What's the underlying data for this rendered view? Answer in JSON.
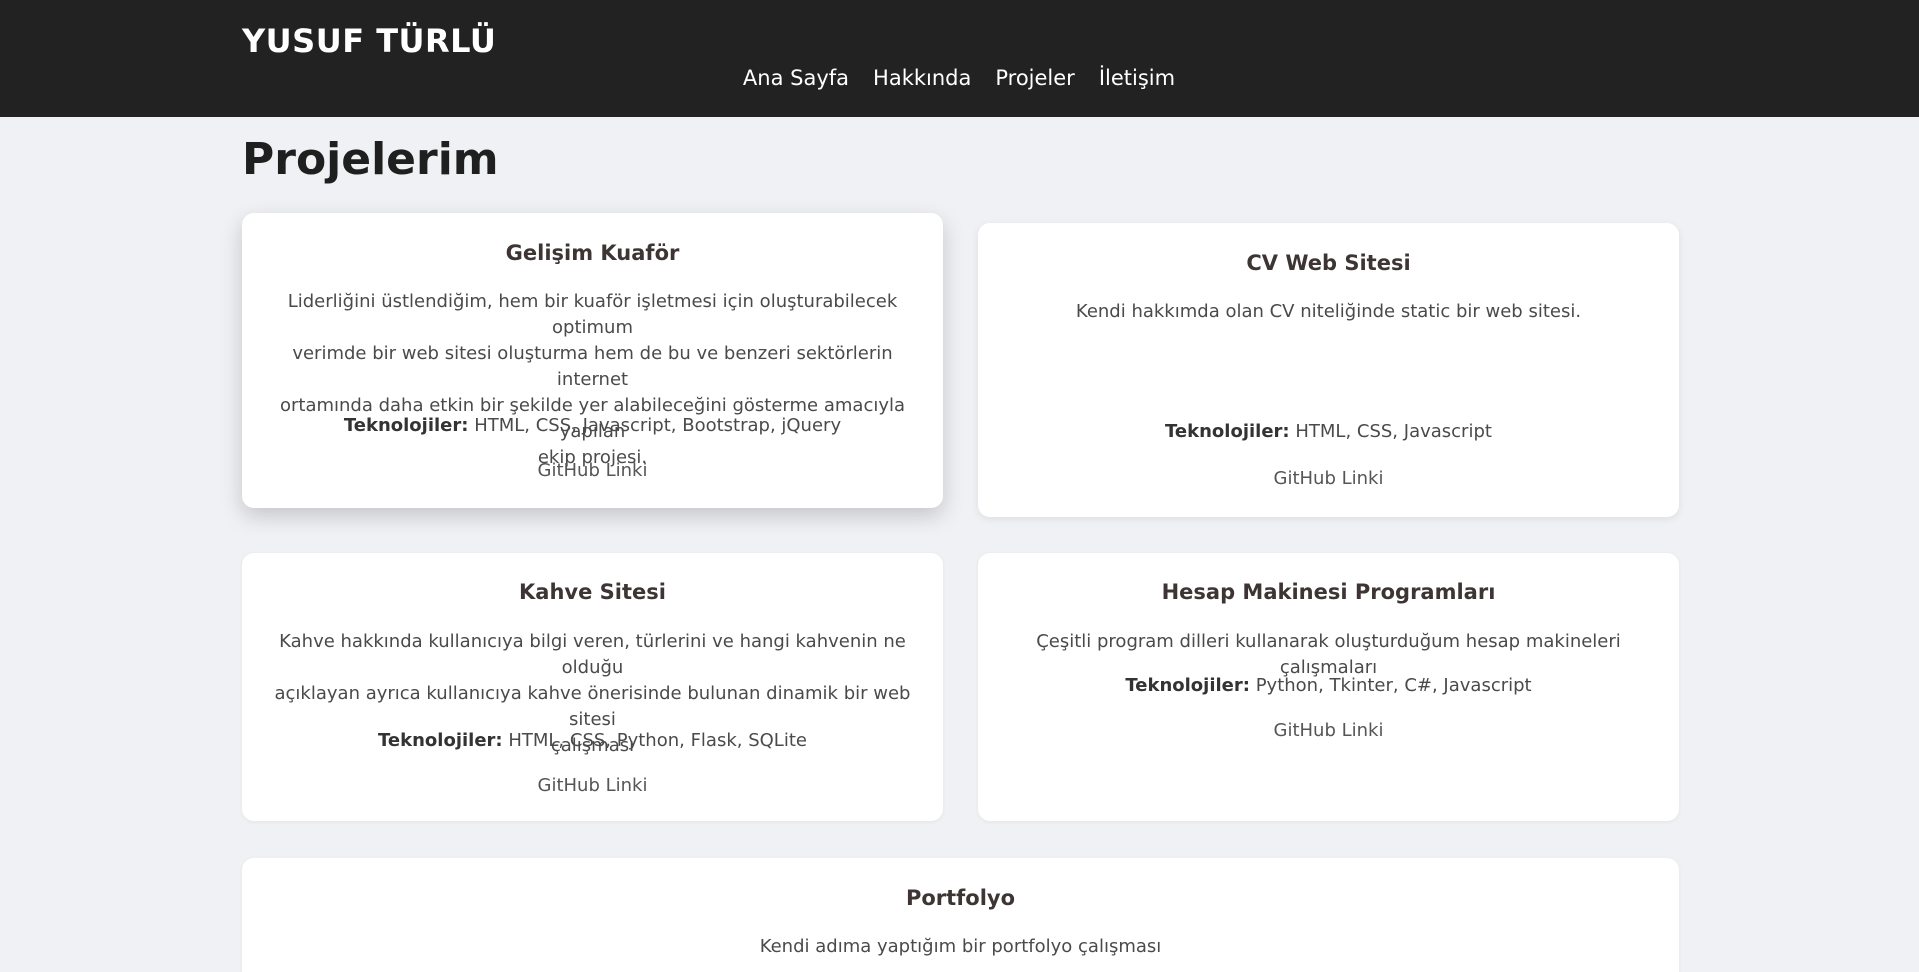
{
  "header": {
    "brand": "YUSUF TÜRLÜ",
    "nav": [
      "Ana Sayfa",
      "Hakkında",
      "Projeler",
      "İletişim"
    ]
  },
  "page": {
    "title": "Projelerim"
  },
  "tech_label": "Teknolojiler:",
  "projects": [
    {
      "title": "Gelişim Kuaför",
      "desc_lines": [
        "Liderliğini üstlendiğim, hem bir kuaför işletmesi için oluşturabilecek optimum",
        "verimde bir web sitesi oluşturma hem de bu ve benzeri sektörlerin internet",
        "ortamında daha etkin bir şekilde yer alabileceğini gösterme amacıyla yapılan",
        "ekip projesi."
      ],
      "tech": "HTML, CSS, Javascript, Bootstrap, jQuery",
      "link": "GitHub Linki"
    },
    {
      "title": "CV Web Sitesi",
      "desc_lines": [
        "Kendi hakkımda olan CV niteliğinde static bir web sitesi."
      ],
      "tech": "HTML, CSS, Javascript",
      "link": "GitHub Linki"
    },
    {
      "title": "Kahve Sitesi",
      "desc_lines": [
        "Kahve hakkında kullanıcıya bilgi veren, türlerini ve hangi kahvenin ne olduğu",
        "açıklayan ayrıca kullanıcıya kahve önerisinde bulunan dinamik bir web sitesi",
        "çalışması"
      ],
      "tech": "HTML, CSS, Python, Flask, SQLite",
      "link": "GitHub Linki"
    },
    {
      "title": "Hesap Makinesi Programları",
      "desc_lines": [
        "Çeşitli program dilleri kullanarak oluşturduğum hesap makineleri çalışmaları"
      ],
      "tech": "Python, Tkinter, C#, Javascript",
      "link": "GitHub Linki"
    },
    {
      "title": "Portfolyo",
      "desc_lines": [
        "Kendi adıma yaptığım bir portfolyo çalışması"
      ]
    }
  ],
  "colors": {
    "header_bg": "#222222",
    "page_bg": "#f0f1f4",
    "card_bg": "#ffffff"
  }
}
